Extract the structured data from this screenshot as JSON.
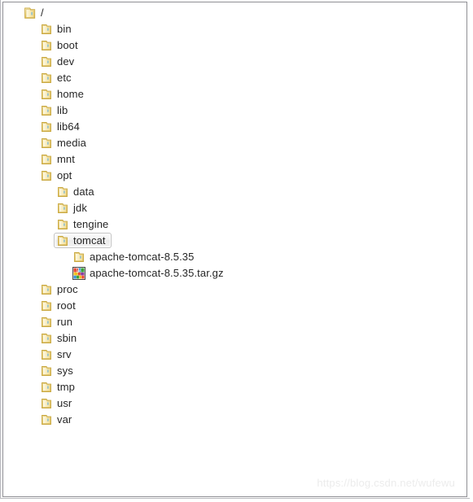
{
  "panel": {
    "watermark": "https://blog.csdn.net/wufewu"
  },
  "tree": {
    "nodes": [
      {
        "label": "/",
        "level": 0,
        "icon": "folder-open-icon",
        "selected": false,
        "type": "folder"
      },
      {
        "label": "bin",
        "level": 1,
        "icon": "folder-icon",
        "selected": false,
        "type": "folder"
      },
      {
        "label": "boot",
        "level": 1,
        "icon": "folder-icon",
        "selected": false,
        "type": "folder"
      },
      {
        "label": "dev",
        "level": 1,
        "icon": "folder-icon",
        "selected": false,
        "type": "folder"
      },
      {
        "label": "etc",
        "level": 1,
        "icon": "folder-icon",
        "selected": false,
        "type": "folder"
      },
      {
        "label": "home",
        "level": 1,
        "icon": "folder-icon",
        "selected": false,
        "type": "folder"
      },
      {
        "label": "lib",
        "level": 1,
        "icon": "folder-icon",
        "selected": false,
        "type": "folder"
      },
      {
        "label": "lib64",
        "level": 1,
        "icon": "folder-icon",
        "selected": false,
        "type": "folder"
      },
      {
        "label": "media",
        "level": 1,
        "icon": "folder-icon",
        "selected": false,
        "type": "folder"
      },
      {
        "label": "mnt",
        "level": 1,
        "icon": "folder-icon",
        "selected": false,
        "type": "folder"
      },
      {
        "label": "opt",
        "level": 1,
        "icon": "folder-icon",
        "selected": false,
        "type": "folder"
      },
      {
        "label": "data",
        "level": 2,
        "icon": "folder-icon",
        "selected": false,
        "type": "folder"
      },
      {
        "label": "jdk",
        "level": 2,
        "icon": "folder-icon",
        "selected": false,
        "type": "folder"
      },
      {
        "label": "tengine",
        "level": 2,
        "icon": "folder-icon",
        "selected": false,
        "type": "folder"
      },
      {
        "label": "tomcat",
        "level": 2,
        "icon": "folder-icon",
        "selected": true,
        "type": "folder"
      },
      {
        "label": "apache-tomcat-8.5.35",
        "level": 3,
        "icon": "folder-icon",
        "selected": false,
        "type": "folder"
      },
      {
        "label": "apache-tomcat-8.5.35.tar.gz",
        "level": 3,
        "icon": "archive-winrar-icon",
        "selected": false,
        "type": "archive"
      },
      {
        "label": "proc",
        "level": 1,
        "icon": "folder-icon",
        "selected": false,
        "type": "folder"
      },
      {
        "label": "root",
        "level": 1,
        "icon": "folder-icon",
        "selected": false,
        "type": "folder"
      },
      {
        "label": "run",
        "level": 1,
        "icon": "folder-icon",
        "selected": false,
        "type": "folder"
      },
      {
        "label": "sbin",
        "level": 1,
        "icon": "folder-icon",
        "selected": false,
        "type": "folder"
      },
      {
        "label": "srv",
        "level": 1,
        "icon": "folder-icon",
        "selected": false,
        "type": "folder"
      },
      {
        "label": "sys",
        "level": 1,
        "icon": "folder-icon",
        "selected": false,
        "type": "folder"
      },
      {
        "label": "tmp",
        "level": 1,
        "icon": "folder-icon",
        "selected": false,
        "type": "folder"
      },
      {
        "label": "usr",
        "level": 1,
        "icon": "folder-icon",
        "selected": false,
        "type": "folder"
      },
      {
        "label": "var",
        "level": 1,
        "icon": "folder-icon",
        "selected": false,
        "type": "folder"
      }
    ]
  },
  "colors": {
    "folder_light": "#fdf4c8",
    "folder_mid": "#f0d77a",
    "folder_dark": "#d8b24a",
    "panel_border": "#8f8f94",
    "text": "#262626",
    "watermark": "#ececec"
  }
}
